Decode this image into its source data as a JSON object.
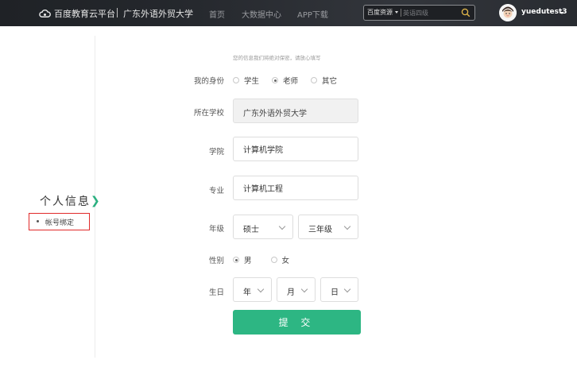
{
  "header": {
    "logo_text": "百度教育云平台",
    "school_name": "广东外语外贸大学",
    "nav": [
      "首页",
      "大数据中心",
      "APP下载"
    ],
    "search": {
      "scope": "百度资源",
      "placeholder": "英语四级"
    },
    "username": "yuedutest3"
  },
  "sidebar": {
    "title": "个人信息",
    "items": [
      {
        "label": "帐号绑定"
      }
    ]
  },
  "form": {
    "notice": "您的信息我们将绝对保密，请放心填写",
    "identity": {
      "label": "我的身份",
      "options": [
        "学生",
        "老师",
        "其它"
      ],
      "selected": "老师"
    },
    "school": {
      "label": "所在学校",
      "value": "广东外语外贸大学"
    },
    "college": {
      "label": "学院",
      "value": "计算机学院"
    },
    "major": {
      "label": "专业",
      "value": "计算机工程"
    },
    "grade": {
      "label": "年级",
      "degree": "硕士",
      "year": "三年级"
    },
    "gender": {
      "label": "性别",
      "options": [
        "男",
        "女"
      ],
      "selected": "男"
    },
    "birthday": {
      "label": "生日",
      "year": "年",
      "month": "月",
      "day": "日"
    },
    "submit_label": "提 交"
  },
  "colors": {
    "accent": "#2db683",
    "header_bg": "#272a2f",
    "highlight_border": "#e02a2a"
  }
}
